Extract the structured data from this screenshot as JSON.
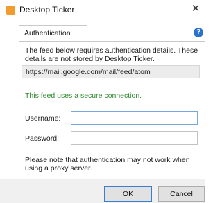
{
  "window": {
    "title": "Desktop Ticker",
    "close_glyph": "✕",
    "app_icon": "rss-feed-icon"
  },
  "tabs": [
    {
      "label": "Authentication"
    }
  ],
  "help": {
    "glyph": "?",
    "icon": "help-icon"
  },
  "content": {
    "notice": "The feed below requires authentication details. These details are not stored by Desktop Ticker.",
    "feed_url": "https://mail.google.com/mail/feed/atom",
    "secure_message": "This feed uses a secure connection.",
    "username_label": "Username:",
    "password_label": "Password:",
    "username_value": "",
    "password_value": "",
    "proxy_note": "Please note that authentication may not work when using a proxy server."
  },
  "buttons": {
    "ok": "OK",
    "cancel": "Cancel"
  },
  "colors": {
    "secure_text": "#2e8b2e",
    "app_icon": "#f29b2f",
    "help_icon": "#2a73cc"
  }
}
